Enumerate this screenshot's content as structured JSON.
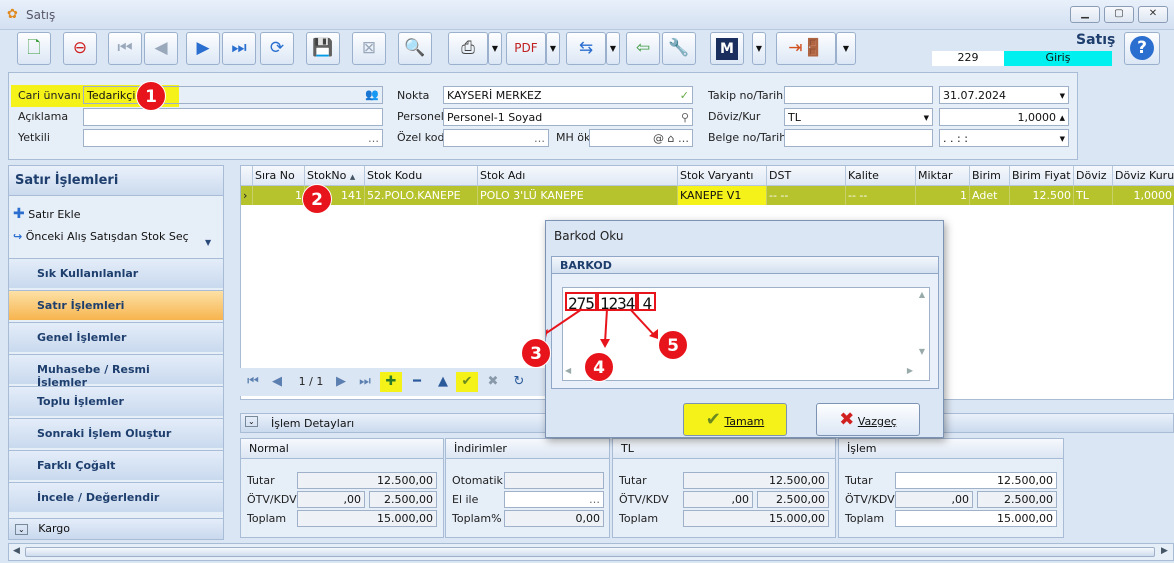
{
  "window": {
    "title": "Satış"
  },
  "toolbar": {
    "module_title": "Satış",
    "doc_number": "229",
    "direction": "Giriş"
  },
  "header": {
    "cari_label": "Cari ünvanı",
    "cari_value": "Tedarikçi 1",
    "aciklama_label": "Açıklama",
    "yetkili_label": "Yetkili",
    "nokta_label": "Nokta",
    "nokta_value": "KAYSERİ MERKEZ",
    "personel_label": "Personel",
    "personel_value": "Personel-1 Soyad",
    "ozelkod_label": "Özel kod",
    "mhok_label": "MH ök",
    "takip_label": "Takip no/Tarih",
    "takip_date": "31.07.2024",
    "doviz_label": "Döviz/Kur",
    "doviz_value": "TL",
    "kur_value": "1,0000",
    "belge_label": "Belge no/Tarih",
    "belge_date": ". .   :  :"
  },
  "left_panel": {
    "title": "Satır İşlemleri",
    "actions": [
      "Satır Ekle",
      "Önceki Alış Satışdan Stok Seç"
    ],
    "nav": [
      "Sık Kullanılanlar",
      "Satır İşlemleri",
      "Genel İşlemler",
      "Muhasebe / Resmi İşlemler",
      "Toplu İşlemler",
      "Sonraki İşlem Oluştur",
      "Farklı Çoğalt",
      "İncele / Değerlendir"
    ],
    "kargo": "Kargo"
  },
  "grid": {
    "columns": [
      "Sıra No",
      "StokNo",
      "Stok Kodu",
      "Stok Adı",
      "Stok Varyantı",
      "DST",
      "Kalite",
      "Miktar",
      "Birim",
      "Birim Fiyat",
      "Döviz",
      "Döviz Kuru"
    ],
    "row": [
      "1",
      "141",
      "52.POLO.KANEPE",
      "POLO 3'LÜ KANEPE",
      "KANEPE V1",
      "-- --",
      "-- --",
      "1",
      "Adet",
      "12.500",
      "TL",
      "1,0000"
    ],
    "page": "1 / 1"
  },
  "details": {
    "bar_label": "İşlem Detayları",
    "normal": {
      "title": "Normal",
      "tutar_label": "Tutar",
      "tutar": "12.500,00",
      "otv_label": "ÖTV/KDV",
      "otv": ",00",
      "kdv": "2.500,00",
      "toplam_label": "Toplam",
      "toplam": "15.000,00"
    },
    "indirimler": {
      "title": "İndirimler",
      "otomatik_label": "Otomatik",
      "elile_label": "El ile",
      "toplam_label": "Toplam%",
      "toplam": "0,00"
    },
    "tl": {
      "title": "TL",
      "tutar_label": "Tutar",
      "tutar": "12.500,00",
      "otv_label": "ÖTV/KDV",
      "otv": ",00",
      "kdv": "2.500,00",
      "toplam_label": "Toplam",
      "toplam": "15.000,00"
    },
    "islem": {
      "title": "İşlem",
      "tutar_label": "Tutar",
      "tutar": "12.500,00",
      "otv_label": "ÖTV/KDV",
      "otv": ",00",
      "kdv": "2.500,00",
      "toplam_label": "Toplam",
      "toplam": "15.000,00"
    }
  },
  "dialog": {
    "title": "Barkod Oku",
    "group": "BARKOD",
    "barcode_part1": "275",
    "barcode_part2": "1234",
    "barcode_part3": "4",
    "ok_label": "Tamam",
    "cancel_label": "Vazgeç"
  },
  "markers": [
    "1",
    "2",
    "3",
    "4",
    "5"
  ],
  "colors": {
    "highlight": "#f5f21a",
    "row": "#b6c32c",
    "marker": "#e8141c",
    "giris": "#00f0f0"
  }
}
